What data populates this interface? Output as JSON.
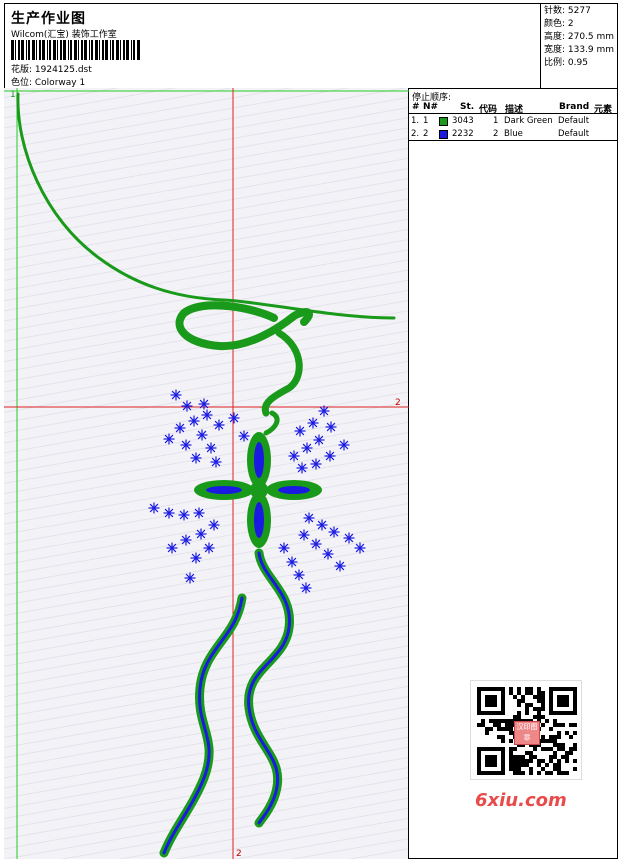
{
  "header": {
    "title": "生产作业图",
    "subtitle": "Wilcom(汇宝) 装饰工作室",
    "design_label": "花版: 1924125.dst",
    "colorway_label": "色位: Colorway 1"
  },
  "stats": {
    "stitches": "针数: 5277",
    "colors": "颜色: 2",
    "height": "高度: 270.5 mm",
    "width": "宽度: 133.9 mm",
    "scale": "比例: 0.95"
  },
  "stop_sequence": {
    "title": "停止顺序:",
    "columns": [
      "#",
      "N#",
      "St.",
      "代码",
      "描述",
      "Brand",
      "元素"
    ],
    "rows": [
      {
        "index": "1.",
        "needle": "1",
        "color": "#1a9a1a",
        "stitches": "3043",
        "code": "1",
        "description": "Dark Green",
        "brand": "Default"
      },
      {
        "index": "2.",
        "needle": "2",
        "color": "#1a1ae0",
        "stitches": "2232",
        "code": "2",
        "description": "Blue",
        "brand": "Default"
      }
    ]
  },
  "guides": {
    "corner_label": "1",
    "h_label": "2",
    "v_label": "2"
  },
  "watermark": "6xiu.com",
  "stamp_text": "汉印图章"
}
